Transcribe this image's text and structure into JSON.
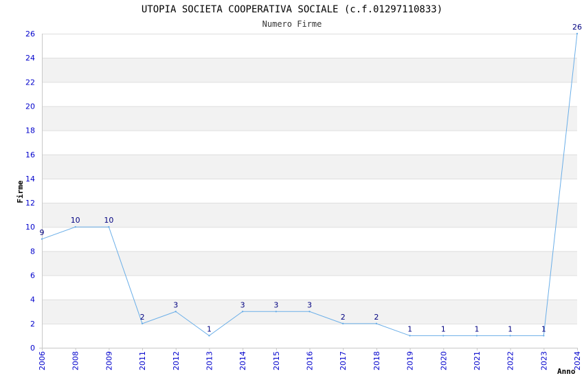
{
  "chart_data": {
    "type": "line",
    "title": "UTOPIA SOCIETA COOPERATIVA SOCIALE (c.f.01297110833)",
    "subtitle": "Numero Firme",
    "xlabel": "Anno",
    "ylabel": "Firme",
    "categories": [
      "2006",
      "2008",
      "2009",
      "2011",
      "2012",
      "2013",
      "2014",
      "2015",
      "2016",
      "2017",
      "2018",
      "2019",
      "2020",
      "2021",
      "2022",
      "2023",
      "2024"
    ],
    "values": [
      9,
      10,
      10,
      2,
      3,
      1,
      3,
      3,
      3,
      2,
      2,
      1,
      1,
      1,
      1,
      1,
      26
    ],
    "ylim": [
      0,
      26
    ],
    "yticks": [
      0,
      2,
      4,
      6,
      8,
      10,
      12,
      14,
      16,
      18,
      20,
      22,
      24,
      26
    ],
    "grid": true,
    "colors": {
      "line": "#6aaee8",
      "band": "#f2f2f2",
      "tick": "#0000cc",
      "data_label": "#000080"
    }
  }
}
